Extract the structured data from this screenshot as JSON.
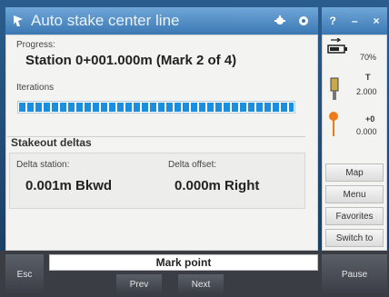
{
  "window": {
    "title": "Auto stake center line",
    "topright_question": "?",
    "topright_minimize": "–",
    "topright_close": "×"
  },
  "progress": {
    "label": "Progress:",
    "value": "Station 0+001.000m (Mark 2 of 4)",
    "iterations_label": "Iterations",
    "iterations_fraction": 1.0
  },
  "deltas": {
    "title": "Stakeout deltas",
    "station_label": "Delta station:",
    "station_value": "0.001m Bkwd",
    "offset_label": "Delta offset:",
    "offset_value": "0.000m Right"
  },
  "status": {
    "battery": "70%",
    "t_value": "2.000",
    "plus0_value": "0.000"
  },
  "sidebar_buttons": [
    "Map",
    "Menu",
    "Favorites",
    "Switch to"
  ],
  "bottom": {
    "esc": "Esc",
    "pause": "Pause",
    "mark_point": "Mark point",
    "prev": "Prev",
    "next": "Next"
  },
  "colors": {
    "accent": "#1a8fe0",
    "title_bar": "#4d8ac4"
  }
}
